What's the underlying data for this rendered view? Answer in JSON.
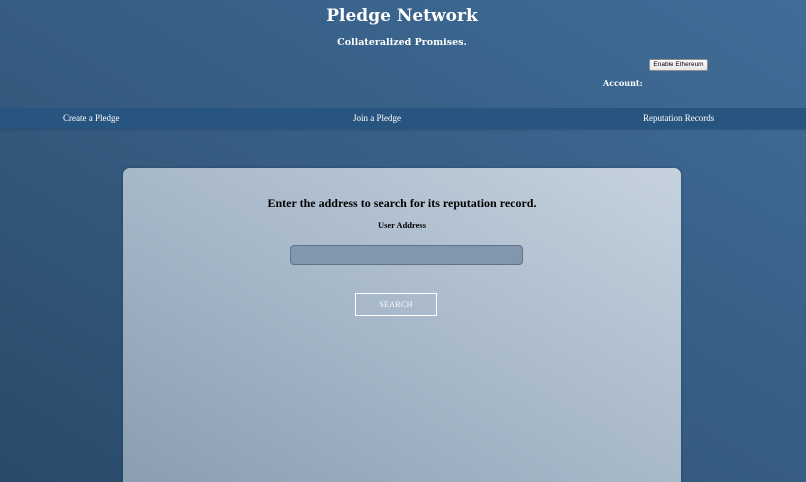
{
  "header": {
    "title": "Pledge Network",
    "tagline": "Collateralized Promises.",
    "enable_button_label": "Enable Ethereum",
    "account_label": "Account:"
  },
  "nav": {
    "items": [
      {
        "label": "Create a Pledge"
      },
      {
        "label": "Join a Pledge"
      },
      {
        "label": "Reputation Records"
      }
    ]
  },
  "search_form": {
    "heading": "Enter the address to search for its reputation record.",
    "address_label": "User Address",
    "address_value": "",
    "search_button_label": "SEARCH"
  },
  "colors": {
    "background": "#355b80",
    "nav_bar": "#27557f",
    "card": "#a7b8c9",
    "input": "#8197ad"
  }
}
